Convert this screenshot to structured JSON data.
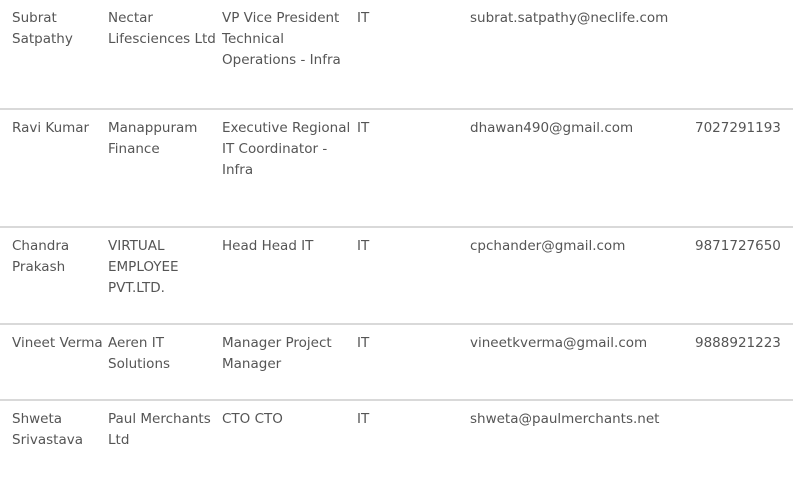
{
  "contacts": [
    {
      "name": "Subrat Satpathy",
      "company": "Nectar Lifesciences Ltd",
      "designation": "VP Vice President Technical Operations - Infra",
      "department": "IT",
      "email": "subrat.satpathy@neclife.com",
      "phone": ""
    },
    {
      "name": "Ravi Kumar",
      "company": "Manappuram Finance",
      "designation": "Executive Regional IT Coordinator - Infra",
      "department": "IT",
      "email": "dhawan490@gmail.com",
      "phone": "7027291193"
    },
    {
      "name": "Chandra Prakash",
      "company": "VIRTUAL EMPLOYEE PVT.LTD.",
      "designation": "Head Head IT",
      "department": "IT",
      "email": "cpchander@gmail.com",
      "phone": "9871727650"
    },
    {
      "name": "Vineet Verma",
      "company": "Aeren IT Solutions",
      "designation": "Manager Project Manager",
      "department": "IT",
      "email": "vineetkverma@gmail.com",
      "phone": "9888921223"
    },
    {
      "name": "Shweta Srivastava",
      "company": "Paul Merchants Ltd",
      "designation": "CTO CTO",
      "department": "IT",
      "email": "shweta@paulmerchants.net",
      "phone": ""
    }
  ]
}
